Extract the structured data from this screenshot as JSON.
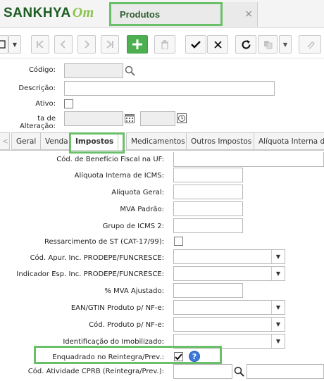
{
  "header": {
    "logo_main": "SANKHYA",
    "logo_suffix": "Om",
    "tab_title": "Produtos",
    "tab_close": "×"
  },
  "toolbar": {
    "buttons": [
      "menu-icon",
      "dropdown-icon",
      "first-record-icon",
      "previous-record-icon",
      "next-record-icon",
      "last-record-icon",
      "add-icon",
      "delete-icon",
      "save-icon",
      "cancel-icon",
      "refresh-icon",
      "copy-icon",
      "dropdown-icon",
      "attach-icon"
    ]
  },
  "header_form": {
    "codigo_label": "Código:",
    "codigo_value": "",
    "descricao_label": "Descrição:",
    "descricao_value": "",
    "ativo_label": "Ativo:",
    "data_alteracao_label": "ta de Alteração:",
    "data_value": "",
    "hora_value": ""
  },
  "subtabs": {
    "prev": "<",
    "items": [
      "Geral",
      "Venda",
      "Impostos",
      "Medicamentos",
      "Outros Impostos",
      "Alíquota Interna de"
    ]
  },
  "impostos": {
    "beneficio_label": "Cód. de Benefício Fiscal na UF:",
    "aliq_icms_label": "Alíquota Interna de ICMS:",
    "aliq_geral_label": "Alíquota Geral:",
    "mva_label": "MVA Padrão:",
    "grupo_label": "Grupo de ICMS 2:",
    "ressarcimento_label": "Ressarcimento de ST (CAT-17/99):",
    "apur_label": "Cód. Apur. Inc. PRODEPE/FUNCRESCE:",
    "indicador_label": "Indicador Esp. Inc. PRODEPE/FUNCRESCE:",
    "mva_ajustado_label": "% MVA Ajustado:",
    "ean_label": "EAN/GTIN Produto p/ NF-e:",
    "cod_produto_label": "Cód. Produto p/ NF-e:",
    "imobilizado_label": "Identificação do Imobilizado:",
    "reintegra_label": "Enquadrado no Reintegra/Prev.:",
    "cprb_label": "Cód. Atividade CPRB (Reintegra/Prev.):",
    "help": "?"
  }
}
